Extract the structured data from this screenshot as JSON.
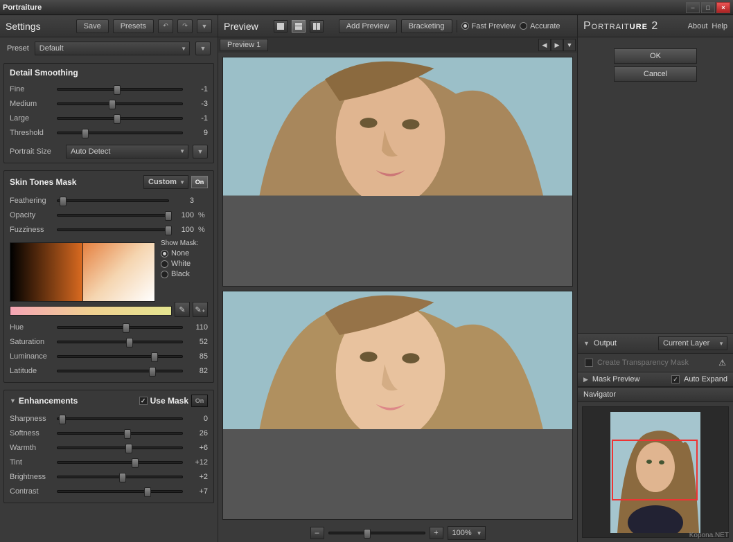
{
  "window": {
    "title": "Portraiture"
  },
  "left": {
    "settings": "Settings",
    "save": "Save",
    "presets": "Presets",
    "preset_label": "Preset",
    "preset_value": "Default",
    "detail": {
      "title": "Detail Smoothing",
      "fine": {
        "label": "Fine",
        "value": "-1",
        "pct": 48
      },
      "medium": {
        "label": "Medium",
        "value": "-3",
        "pct": 44
      },
      "large": {
        "label": "Large",
        "value": "-1",
        "pct": 48
      },
      "threshold": {
        "label": "Threshold",
        "value": "9",
        "pct": 22
      },
      "size_label": "Portrait Size",
      "size_value": "Auto Detect"
    },
    "skin": {
      "title": "Skin Tones Mask",
      "mode": "Custom",
      "on": "On",
      "feathering": {
        "label": "Feathering",
        "value": "3",
        "pct": 5
      },
      "opacity": {
        "label": "Opacity",
        "value": "100",
        "pct": 100,
        "suffix": "%"
      },
      "fuzziness": {
        "label": "Fuzziness",
        "value": "100",
        "pct": 100,
        "suffix": "%"
      },
      "show_mask": "Show Mask:",
      "mask_none": "None",
      "mask_white": "White",
      "mask_black": "Black",
      "hue": {
        "label": "Hue",
        "value": "110",
        "pct": 55
      },
      "saturation": {
        "label": "Saturation",
        "value": "52",
        "pct": 58
      },
      "luminance": {
        "label": "Luminance",
        "value": "85",
        "pct": 78
      },
      "latitude": {
        "label": "Latitude",
        "value": "82",
        "pct": 76
      }
    },
    "enh": {
      "title": "Enhancements",
      "use_mask": "Use Mask",
      "on": "On",
      "sharpness": {
        "label": "Sharpness",
        "value": "0",
        "pct": 4
      },
      "softness": {
        "label": "Softness",
        "value": "26",
        "pct": 56
      },
      "warmth": {
        "label": "Warmth",
        "value": "+6",
        "pct": 57
      },
      "tint": {
        "label": "Tint",
        "value": "+12",
        "pct": 62
      },
      "brightness": {
        "label": "Brightness",
        "value": "+2",
        "pct": 52
      },
      "contrast": {
        "label": "Contrast",
        "value": "+7",
        "pct": 72
      }
    }
  },
  "center": {
    "preview": "Preview",
    "add_preview": "Add Preview",
    "bracketing": "Bracketing",
    "fast": "Fast Preview",
    "accurate": "Accurate",
    "tab1": "Preview 1",
    "zoom": "100%"
  },
  "right": {
    "brand1": "Portrait",
    "brand2": "ure",
    "brand3": " 2",
    "about": "About",
    "help": "Help",
    "ok": "OK",
    "cancel": "Cancel",
    "output": "Output",
    "output_val": "Current Layer",
    "transparency": "Create Transparency Mask",
    "mask_preview": "Mask Preview",
    "auto_expand": "Auto Expand",
    "navigator": "Navigator"
  },
  "watermark": "Kopona.NET"
}
